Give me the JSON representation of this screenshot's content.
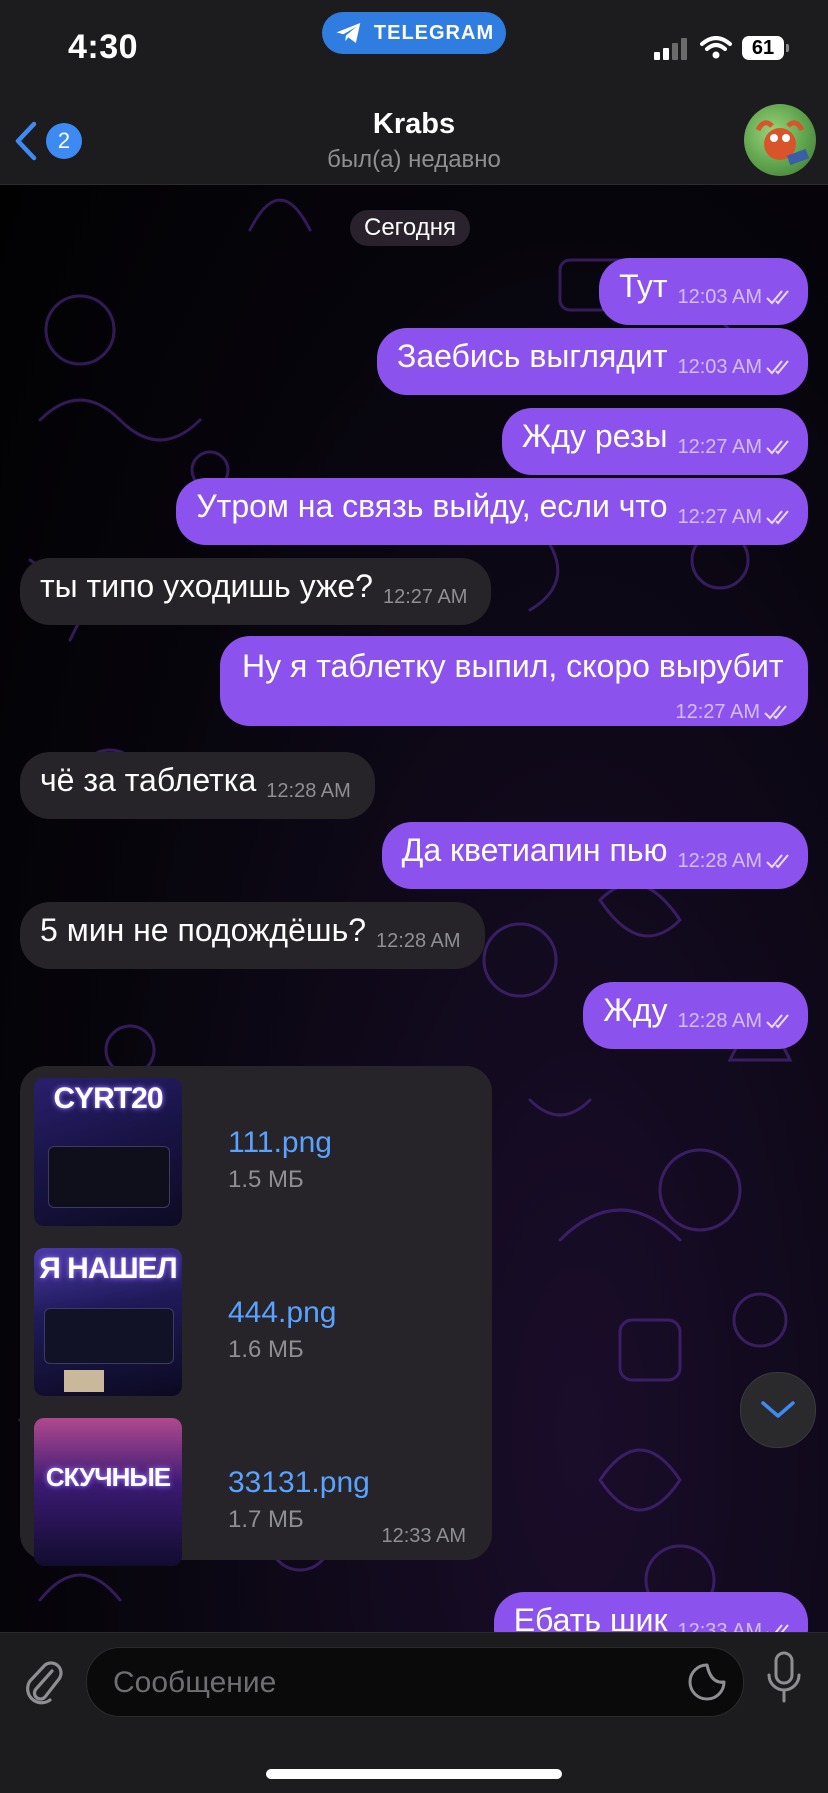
{
  "status_bar": {
    "time": "4:30",
    "app_pill": "TELEGRAM",
    "battery": "61"
  },
  "header": {
    "back_badge": "2",
    "title": "Krabs",
    "subtitle": "был(а) недавно"
  },
  "chat": {
    "date_chip": "Сегодня",
    "messages": [
      {
        "dir": "out",
        "text": "Тут",
        "time": "12:03 AM"
      },
      {
        "dir": "out",
        "text": "Заебись выглядит",
        "time": "12:03 AM"
      },
      {
        "dir": "out",
        "text": "Жду резы",
        "time": "12:27 AM"
      },
      {
        "dir": "out",
        "text": "Утром на связь выйду, если что",
        "time": "12:27 AM"
      },
      {
        "dir": "in",
        "text": "ты типо уходишь уже?",
        "time": "12:27 AM"
      },
      {
        "dir": "out",
        "text": "Ну я таблетку выпил, скоро вырубит",
        "time": "12:27 AM"
      },
      {
        "dir": "in",
        "text": "чё за таблетка",
        "time": "12:28 AM"
      },
      {
        "dir": "out",
        "text": "Да кветиапин пью",
        "time": "12:28 AM"
      },
      {
        "dir": "in",
        "text": "5 мин не подождёшь?",
        "time": "12:28 AM"
      },
      {
        "dir": "out",
        "text": "Жду",
        "time": "12:28 AM"
      },
      {
        "dir": "out",
        "text": "Ебать шик",
        "time": "12:33 AM"
      }
    ],
    "album": {
      "time": "12:33 AM",
      "files": [
        {
          "name": "111.png",
          "size": "1.5 МБ",
          "thumb_caption": "CYRT20"
        },
        {
          "name": "444.png",
          "size": "1.6 МБ",
          "thumb_caption": "Я НАШЕЛ"
        },
        {
          "name": "33131.png",
          "size": "1.7 МБ",
          "thumb_caption": "СКУЧНЫЕ"
        }
      ]
    }
  },
  "input": {
    "placeholder": "Сообщение"
  },
  "icons": {
    "back": "chevron-left-icon",
    "attach": "paperclip-icon",
    "sticker": "sticker-icon",
    "mic": "microphone-icon",
    "scroll_down": "chevron-down-icon",
    "telegram": "telegram-plane-icon",
    "read": "double-check-icon"
  },
  "colors": {
    "outgoing_bubble": "#8c52ee",
    "incoming_bubble": "#262428",
    "link": "#5aa2ff",
    "accent": "#3d8bf2"
  }
}
